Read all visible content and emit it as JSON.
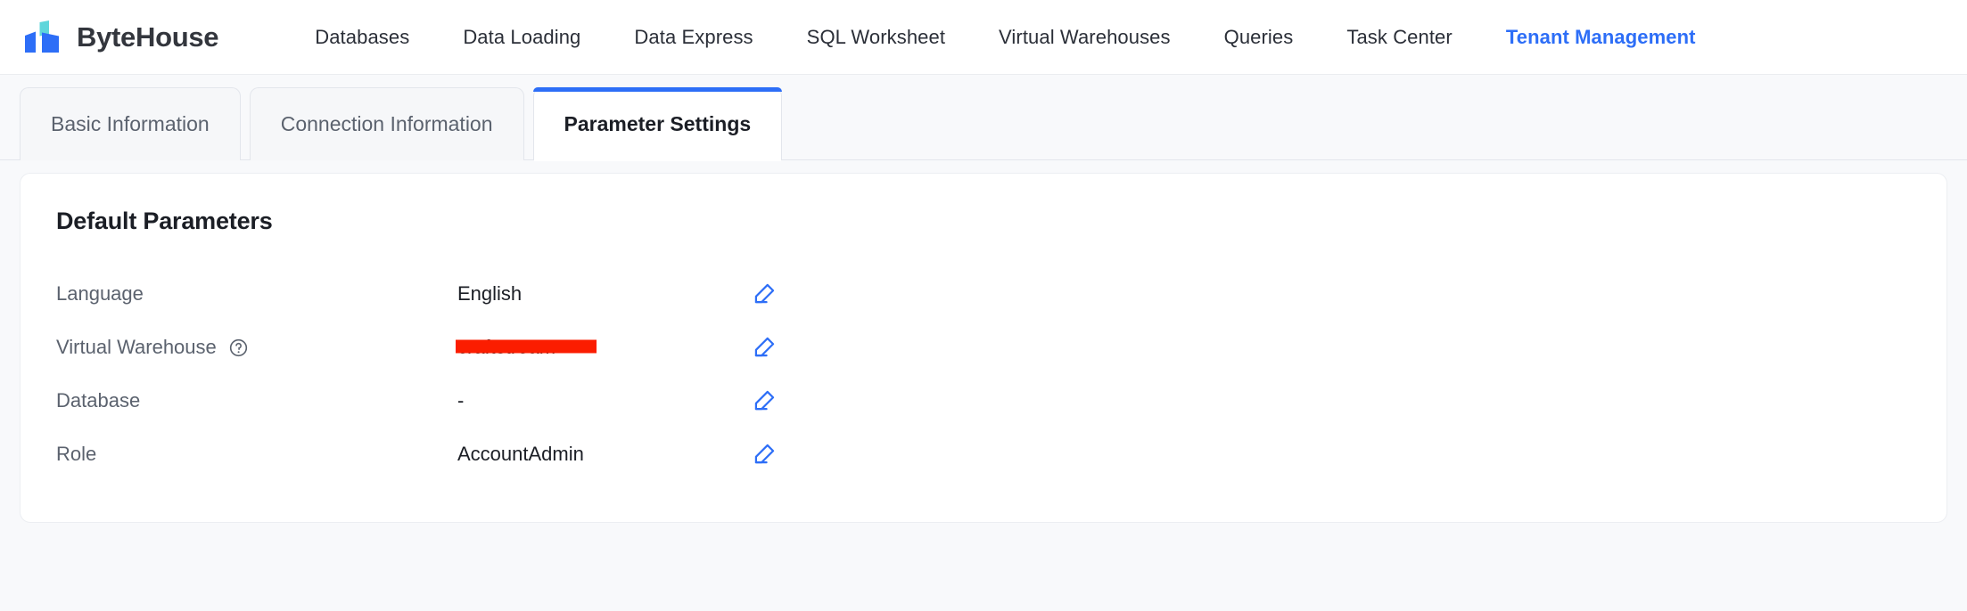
{
  "brand": {
    "name": "ByteHouse",
    "logo_icon": "bytehouse-logo-icon",
    "logo_colors": {
      "primary": "#2d6ef7",
      "accent": "#5ed6db"
    }
  },
  "topnav": {
    "items": [
      {
        "label": "Databases",
        "active": false
      },
      {
        "label": "Data Loading",
        "active": false
      },
      {
        "label": "Data Express",
        "active": false
      },
      {
        "label": "SQL Worksheet",
        "active": false
      },
      {
        "label": "Virtual Warehouses",
        "active": false
      },
      {
        "label": "Queries",
        "active": false
      },
      {
        "label": "Task Center",
        "active": false
      },
      {
        "label": "Tenant Management",
        "active": true
      }
    ],
    "active_color": "#2d6ef7"
  },
  "tabs": [
    {
      "label": "Basic Information",
      "active": false
    },
    {
      "label": "Connection Information",
      "active": false
    },
    {
      "label": "Parameter Settings",
      "active": true
    }
  ],
  "card": {
    "title": "Default Parameters",
    "rows": [
      {
        "label": "Language",
        "has_help": false,
        "value": "English",
        "redacted": false,
        "action_icon": "edit-pencil-icon"
      },
      {
        "label": "Virtual Warehouse",
        "has_help": true,
        "help_icon": "question-circle-icon",
        "value": "craftstream",
        "redacted": true,
        "redaction_color": "#fb1d00",
        "action_icon": "edit-pencil-icon"
      },
      {
        "label": "Database",
        "has_help": false,
        "value": "-",
        "redacted": false,
        "action_icon": "edit-pencil-icon"
      },
      {
        "label": "Role",
        "has_help": false,
        "value": "AccountAdmin",
        "redacted": false,
        "action_icon": "edit-pencil-icon"
      }
    ]
  }
}
